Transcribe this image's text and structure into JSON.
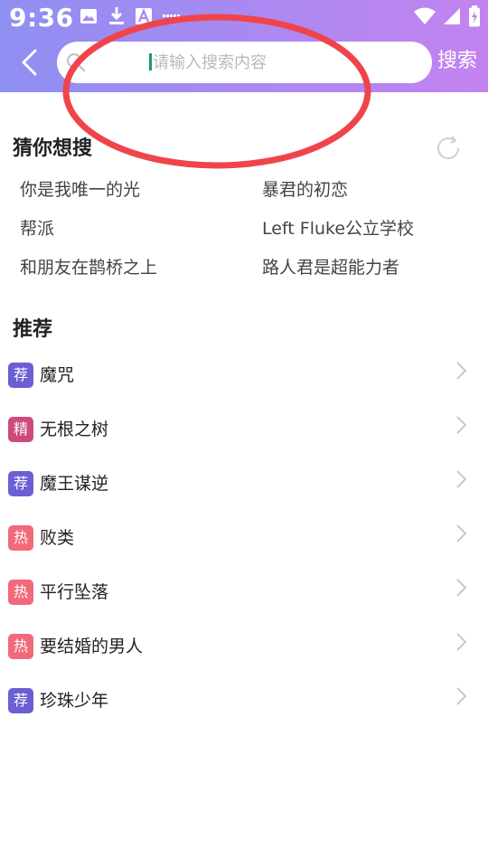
{
  "status_bar": {
    "time": "9:36",
    "left_icons": [
      "image-icon",
      "download-icon",
      "text-a-icon",
      "dots-icon"
    ],
    "right_icons": [
      "wifi-icon",
      "signal-icon",
      "battery-charging-icon"
    ]
  },
  "header": {
    "gradient_start": "#8f8ff2",
    "gradient_end": "#c383f0"
  },
  "search": {
    "placeholder": "请输入搜索内容",
    "value": "",
    "button_label": "搜索"
  },
  "guess": {
    "title": "猜你想搜",
    "items": [
      "你是我唯一的光",
      "暴君的初恋",
      "帮派",
      "Left Fluke公立学校",
      "和朋友在鹊桥之上",
      "路人君是超能力者"
    ]
  },
  "recommend": {
    "title": "推荐",
    "items": [
      {
        "badge": "荐",
        "badge_color": "#6b5fd3",
        "title": "魔咒"
      },
      {
        "badge": "精",
        "badge_color": "#cc4a7c",
        "title": "无根之树"
      },
      {
        "badge": "荐",
        "badge_color": "#6b5fd3",
        "title": "魔王谋逆"
      },
      {
        "badge": "热",
        "badge_color": "#f2697a",
        "title": "败类"
      },
      {
        "badge": "热",
        "badge_color": "#f2697a",
        "title": "平行坠落"
      },
      {
        "badge": "热",
        "badge_color": "#f2697a",
        "title": "要结婚的男人"
      },
      {
        "badge": "荐",
        "badge_color": "#6b5fd3",
        "title": "珍珠少年"
      }
    ]
  },
  "annotation_color": "#f0444b"
}
